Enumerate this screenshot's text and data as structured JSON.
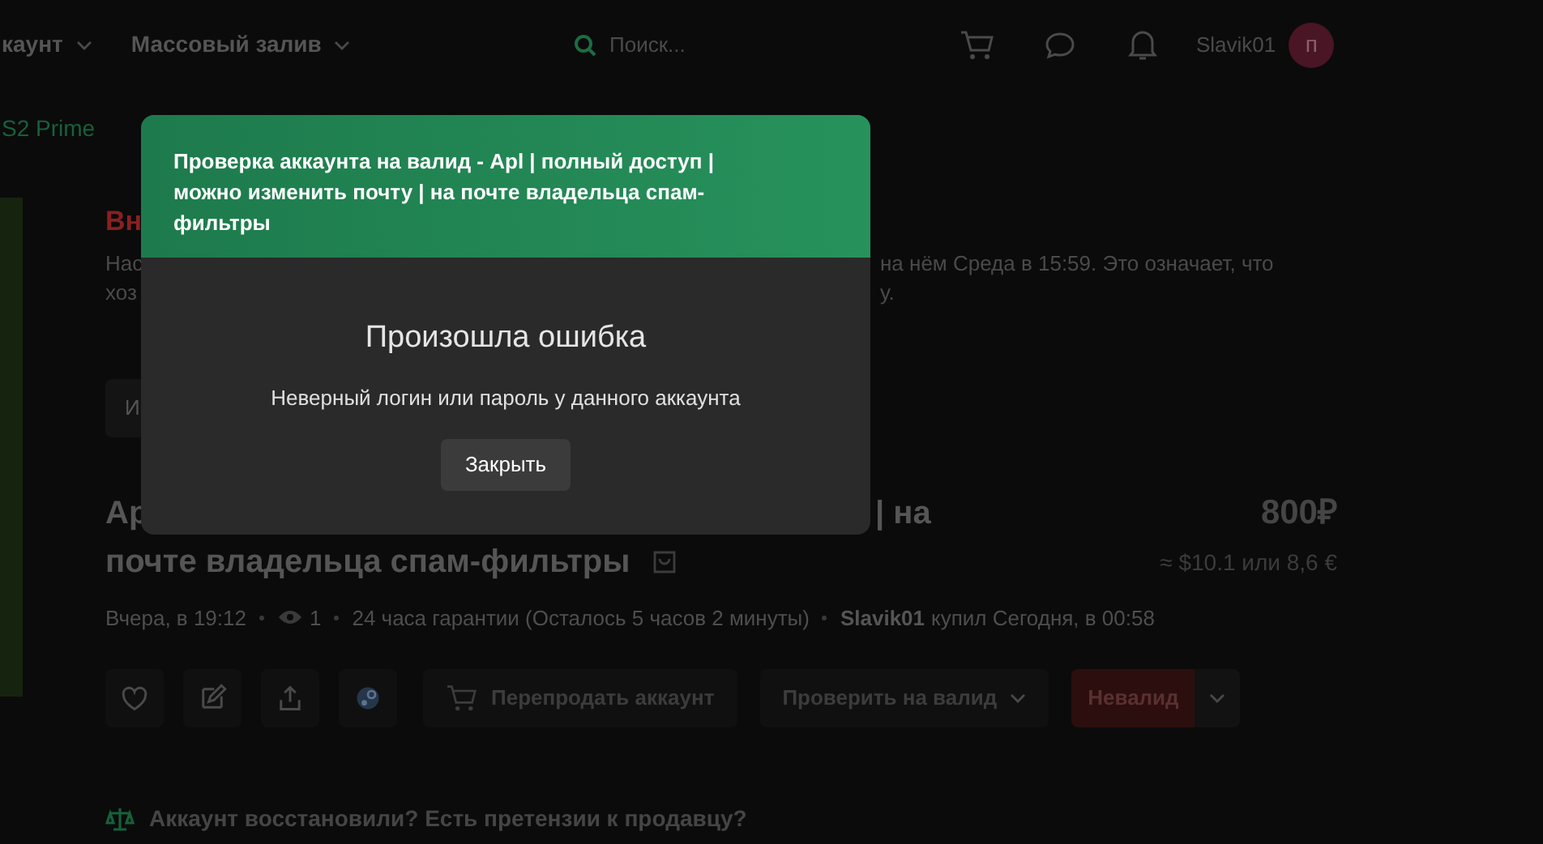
{
  "nav": {
    "items": [
      {
        "label": "каунт"
      },
      {
        "label": "Массовый залив"
      }
    ],
    "search": {
      "placeholder": "Поиск..."
    },
    "user": "Slavik01",
    "avatar": "п"
  },
  "breadcrumb": "S2 Prime",
  "notice": {
    "heading": "Вн",
    "lines": [
      [
        "Нас",
        "на нём Среда в 15:59. Это означает, что"
      ],
      [
        "хоз",
        "у."
      ]
    ]
  },
  "tab_fragment": "И",
  "title": {
    "line1": [
      "Ар",
      "| на"
    ],
    "line2": "почте владельца спам-фильтры"
  },
  "price": "800₽",
  "price_alt": "≈ $10.1 или 8,6 €",
  "meta": {
    "date": "Вчера, в 19:12",
    "views": "1",
    "guarantee": "24 часа гарантии (Осталось 5 часов 2 минуты)",
    "buyer": "Slavik01",
    "bought": "купил Сегодня, в 00:58"
  },
  "actions": [
    {
      "kind": "heart"
    },
    {
      "kind": "edit"
    },
    {
      "kind": "share"
    },
    {
      "kind": "steam"
    }
  ],
  "resell": "Перепродать аккаунт",
  "check": "Проверить на валид",
  "invalid": "Невалид",
  "claim": "Аккаунт восстановили? Есть претензии к продавцу?",
  "modal": {
    "header": "Проверка аккаунта на валид - Apl | полный доступ | можно изменить почту | на почте владельца спам-фильтры",
    "title": "Произошла ошибка",
    "message": "Неверный логин или пароль у данного аккаунта",
    "close": "Закрыть"
  }
}
